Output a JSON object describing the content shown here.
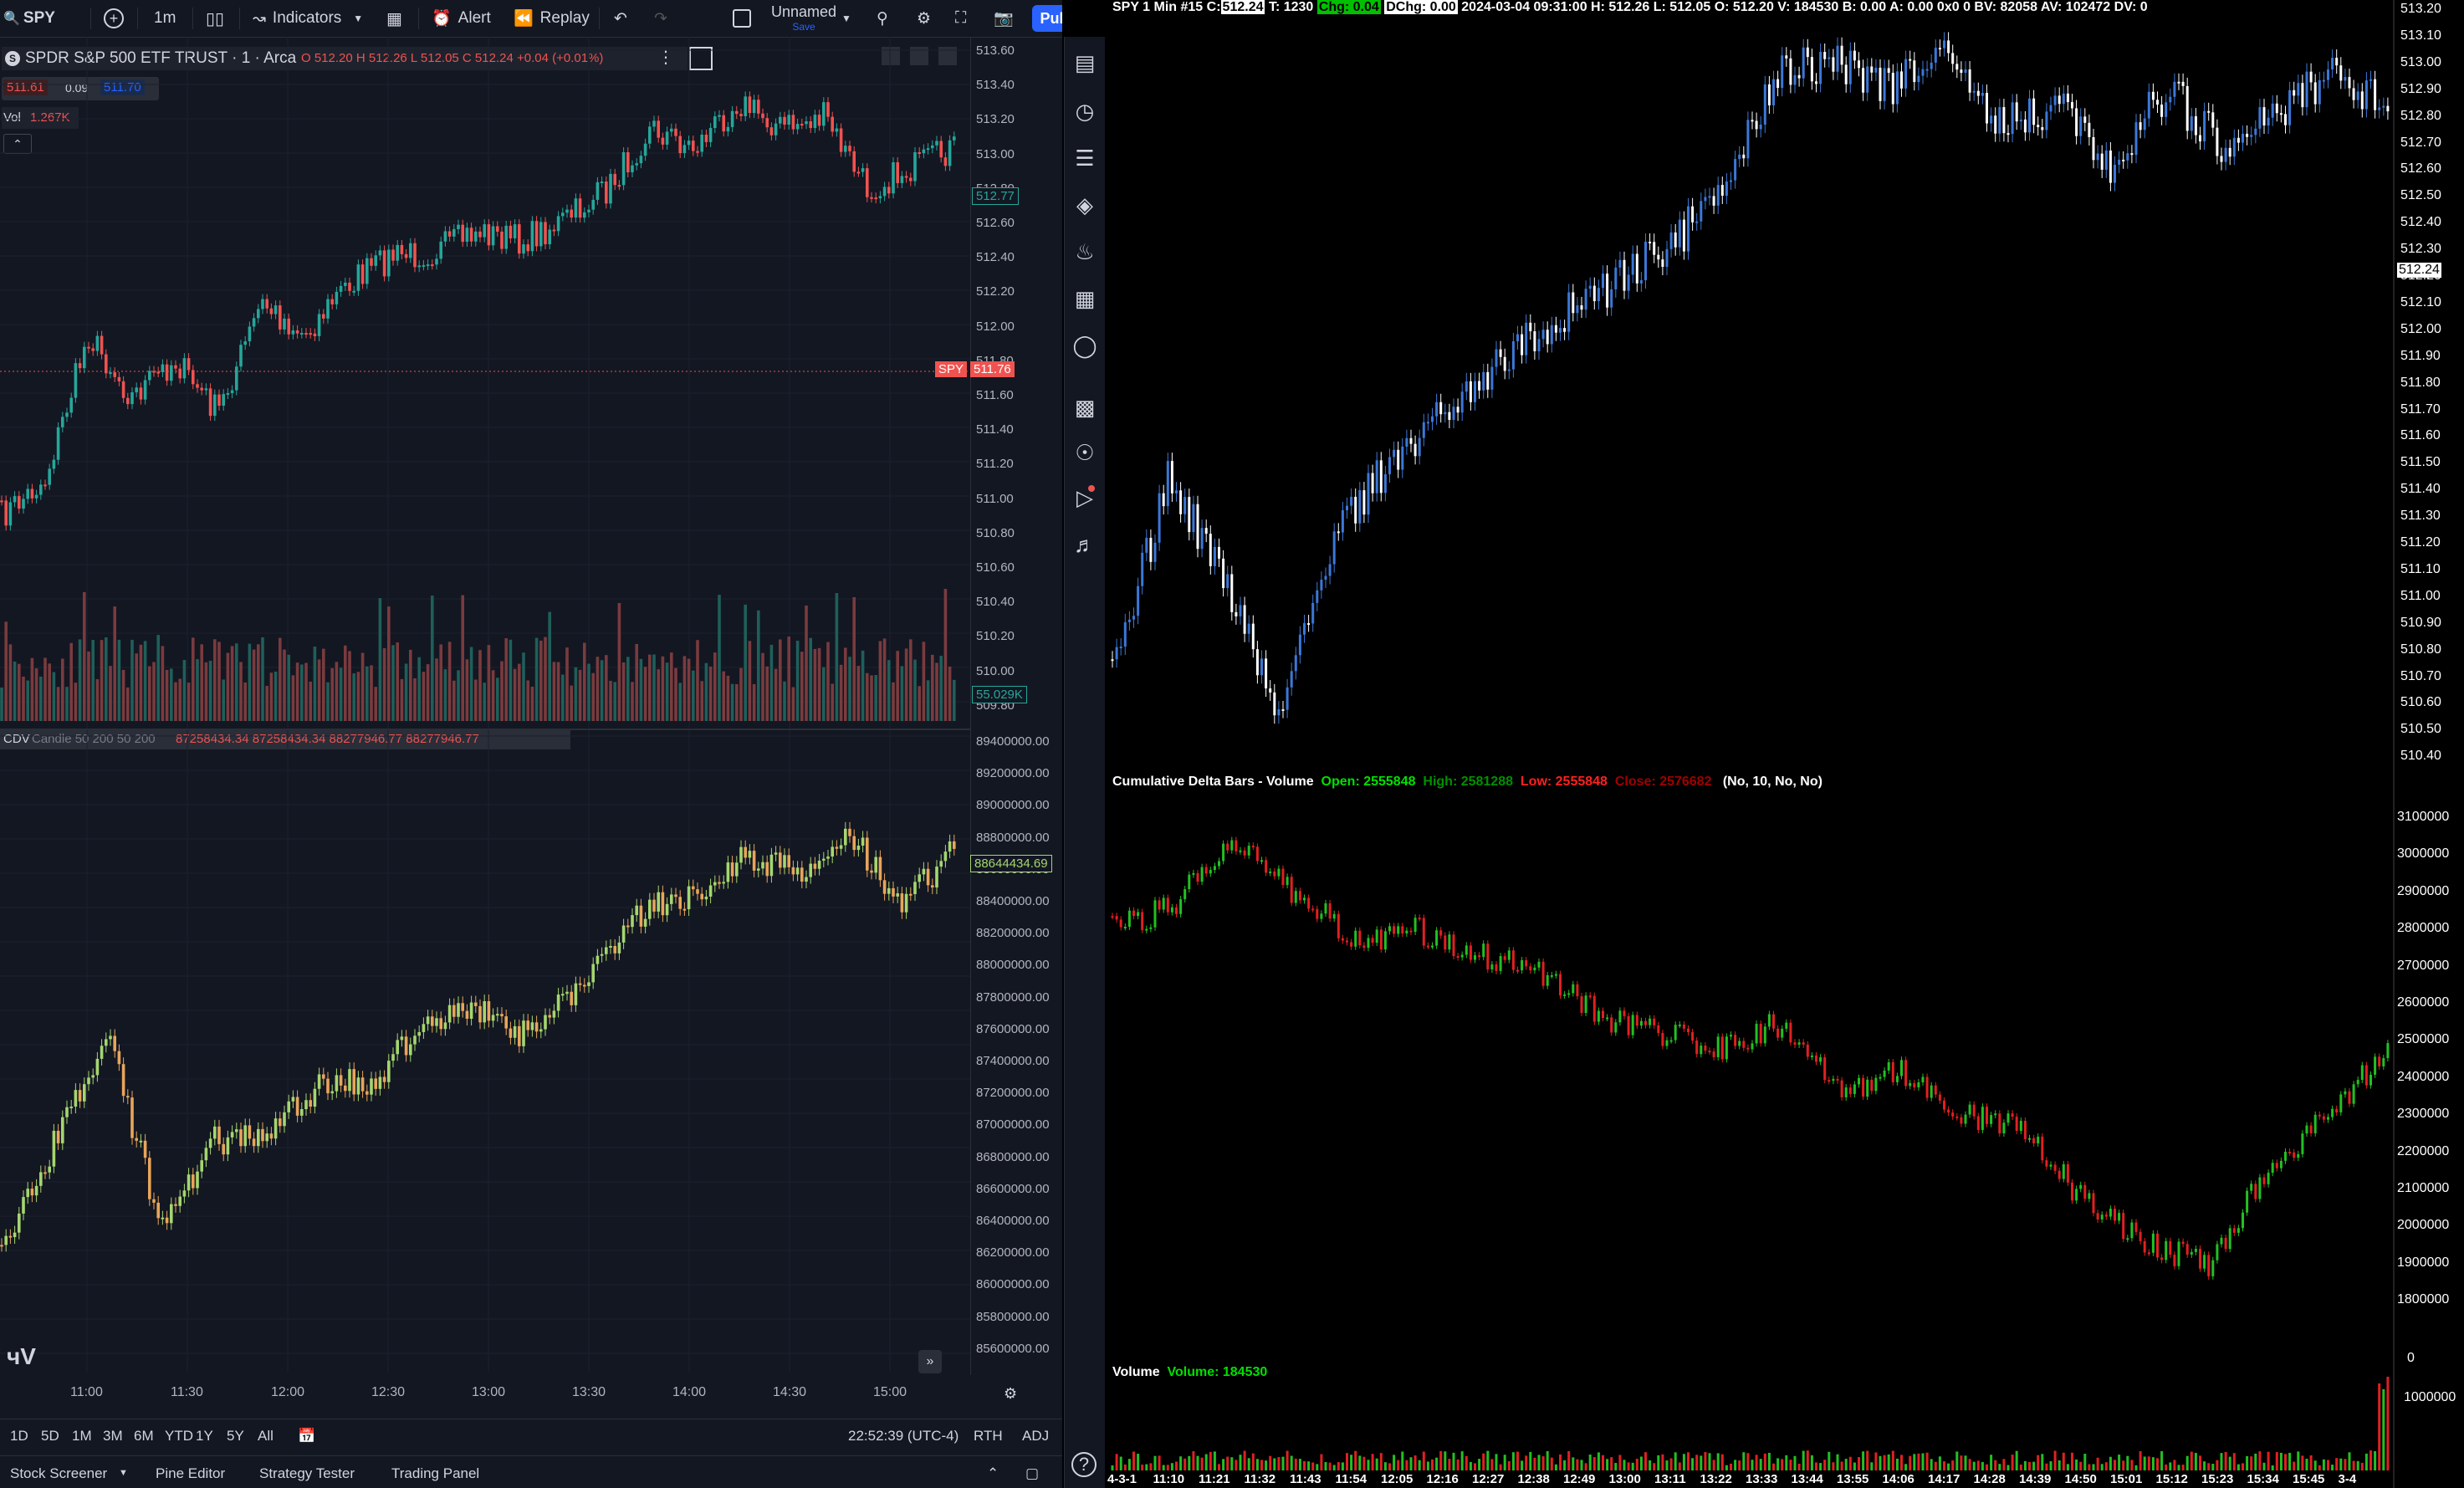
{
  "toolbar": {
    "symbol": "SPY",
    "interval": "1m",
    "indicators_label": "Indicators",
    "alert_label": "Alert",
    "replay_label": "Replay",
    "layout_name": "Unnamed",
    "layout_save": "Save",
    "publish_label": "Publish"
  },
  "legend": {
    "title": "SPDR S&P 500 ETF TRUST · 1 · Arca",
    "sell_price": "511.61",
    "spread": "0.09",
    "buy_price": "511.70",
    "vol_label": "Vol",
    "vol_value": "1.267K",
    "ohlc": "O 512.20 H 512.26 L 512.05 C 512.24 +0.04 (+0.01%)"
  },
  "price_axis": [
    "513.60",
    "513.40",
    "513.20",
    "513.00",
    "512.80",
    "512.60",
    "512.40",
    "512.20",
    "512.00",
    "511.80",
    "511.60",
    "511.40",
    "511.20",
    "511.00",
    "510.80",
    "510.60",
    "510.40",
    "510.20",
    "510.00",
    "509.80"
  ],
  "price_tags": {
    "last": "512.77",
    "symbol_tag": "SPY",
    "symbol_price": "511.76",
    "volume": "55.029K"
  },
  "cdv": {
    "label": "CDV",
    "params": "Candle 50 200 50 200",
    "values": "87258434.34 87258434.34 88277946.77 88277946.77",
    "last_tag": "88644434.69",
    "axis": [
      "89400000.00",
      "89200000.00",
      "89000000.00",
      "88800000.00",
      "88600000.00",
      "88400000.00",
      "88200000.00",
      "88000000.00",
      "87800000.00",
      "87600000.00",
      "87400000.00",
      "87200000.00",
      "87000000.00",
      "86800000.00",
      "86600000.00",
      "86400000.00",
      "86200000.00",
      "86000000.00",
      "85800000.00",
      "85600000.00"
    ]
  },
  "time_axis": [
    "11:00",
    "11:30",
    "12:00",
    "12:30",
    "13:00",
    "13:30",
    "14:00",
    "14:30",
    "15:00"
  ],
  "range_buttons": [
    "1D",
    "5D",
    "1M",
    "3M",
    "6M",
    "YTD",
    "1Y",
    "5Y",
    "All"
  ],
  "status": {
    "clock": "22:52:39 (UTC-4)",
    "session": "RTH",
    "adj": "ADJ"
  },
  "footer_tabs": [
    "Stock Screener",
    "Pine Editor",
    "Strategy Tester",
    "Trading Panel"
  ],
  "right_chart": {
    "header_prefix": "SPY  1 Min  #15",
    "c_label": "C:",
    "c_value": "512.24",
    "t_label": "T: 1230",
    "chg": "Chg: 0.04",
    "dchg": "DChg: 0.00",
    "details": "2024-03-04 09:31:00  H: 512.26  L: 512.05  O: 512.20  V: 184530  B: 0.00  A: 0.00  0x0  0  BV: 82058  AV: 102472  DV: 0",
    "price_axis": [
      "513.20",
      "513.10",
      "513.00",
      "512.90",
      "512.80",
      "512.70",
      "512.60",
      "512.50",
      "512.40",
      "512.30",
      "512.20",
      "512.10",
      "512.00",
      "511.90",
      "511.80",
      "511.70",
      "511.60",
      "511.50",
      "511.40",
      "511.30",
      "511.20",
      "511.10",
      "511.00",
      "510.90",
      "510.80",
      "510.70",
      "510.60",
      "510.50",
      "510.40"
    ],
    "last_price": "512.24",
    "cd_title": "Cumulative Delta Bars - Volume",
    "cd_open": "Open: 2555848",
    "cd_high": "High: 2581288",
    "cd_low": "Low: 2555848",
    "cd_close": "Close: 2576682",
    "cd_params": "(No, 10, No, No)",
    "cd_axis": [
      "3100000",
      "3000000",
      "2900000",
      "2800000",
      "2700000",
      "2600000",
      "2500000",
      "2400000",
      "2300000",
      "2200000",
      "2100000",
      "2000000",
      "1900000",
      "1800000"
    ],
    "vol_title": "Volume",
    "vol_value": "Volume: 184530",
    "vol_axis": "1000000",
    "vol_zero": "0",
    "time_axis": [
      "4-3-1",
      "11:10",
      "11:21",
      "11:32",
      "11:43",
      "11:54",
      "12:05",
      "12:16",
      "12:27",
      "12:38",
      "12:49",
      "13:00",
      "13:11",
      "13:22",
      "13:33",
      "13:44",
      "13:55",
      "14:06",
      "14:17",
      "14:28",
      "14:39",
      "14:50",
      "15:01",
      "15:12",
      "15:23",
      "15:34",
      "15:45",
      "3-4"
    ]
  },
  "colors": {
    "tv_bg": "#131722",
    "up": "#26a69a",
    "down": "#ef5350",
    "blue": "#2962ff",
    "cdv_green": "#a5d66f",
    "right_bg": "#000000"
  }
}
